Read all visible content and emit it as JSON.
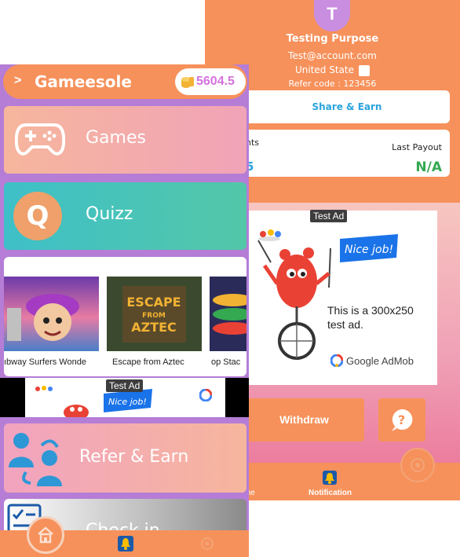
{
  "profile": {
    "avatar_letter": "T",
    "name": "Testing Purpose",
    "email": "Test@account.com",
    "country": "United State",
    "refer_code": "Refer code  : 123456"
  },
  "share_earn_label": "Share & Earn",
  "stats": {
    "left_label": "nts",
    "left_value": "5",
    "right_label": "Last Payout",
    "right_value": "N/A"
  },
  "ad_big": {
    "tag": "Test Ad",
    "flag_text": "Nice job!",
    "text": "This is a 300x250 test ad.",
    "brand": "Google AdMob"
  },
  "withdraw_label": "Withdraw",
  "back_tabs": {
    "home_label": "me",
    "notification_label": "Notification"
  },
  "header": {
    "title": "Gameesole",
    "coins": "5604.5"
  },
  "menu": {
    "games": "Games",
    "quiz": "Quizz",
    "quiz_letter": "Q",
    "refer": "Refer & Earn",
    "checkin": "Check in"
  },
  "games": [
    {
      "label": "ıbway Surfers Wonde"
    },
    {
      "label": "Escape from Aztec",
      "thumb_title": "ESCAPE",
      "thumb_sub": "FROM",
      "thumb_word": "AZTEC"
    },
    {
      "label": "op Stac"
    }
  ],
  "ad_small": {
    "tag": "Test Ad",
    "flag_text": "Nice job!"
  },
  "colors": {
    "primary": "#f6915b",
    "purple": "#b57dd6",
    "teal": "#3ec0c8",
    "blue": "#2aa3dd",
    "green": "#35a852",
    "coin_text": "#d472dd"
  }
}
